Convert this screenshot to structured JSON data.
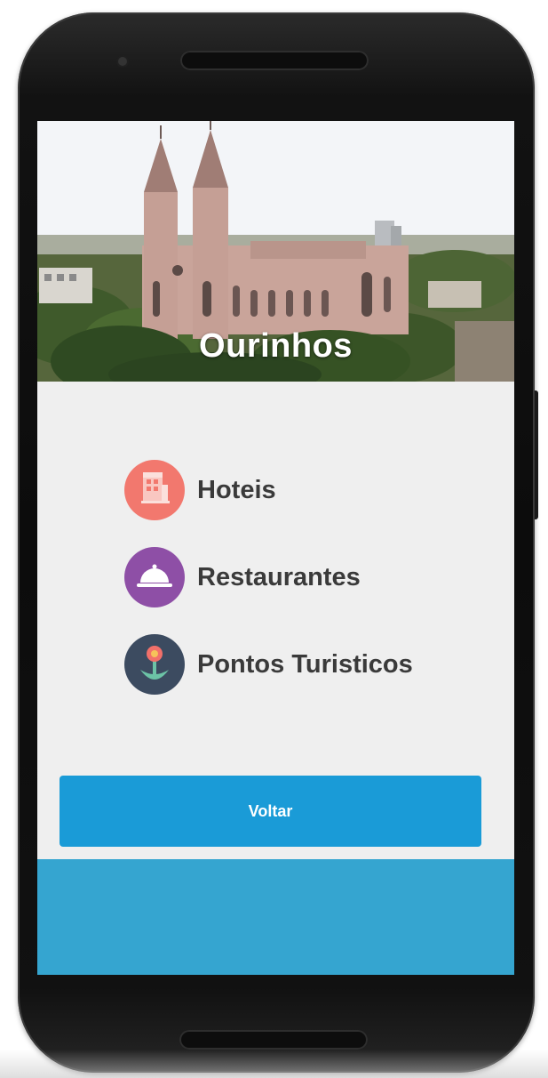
{
  "header": {
    "city_title": "Ourinhos"
  },
  "menu": {
    "items": [
      {
        "label": "Hoteis",
        "icon": "hotel-icon",
        "color": "#f2786e"
      },
      {
        "label": "Restaurantes",
        "icon": "cloche-icon",
        "color": "#8e4fa6"
      },
      {
        "label": "Pontos Turisticos",
        "icon": "flower-icon",
        "color": "#3c4b60"
      }
    ]
  },
  "actions": {
    "back_label": "Voltar",
    "back_color": "#1a9bd7"
  },
  "theme": {
    "screen_background": "#efefef",
    "footer_color": "#35a5d0",
    "text_color": "#3a3a3a"
  }
}
